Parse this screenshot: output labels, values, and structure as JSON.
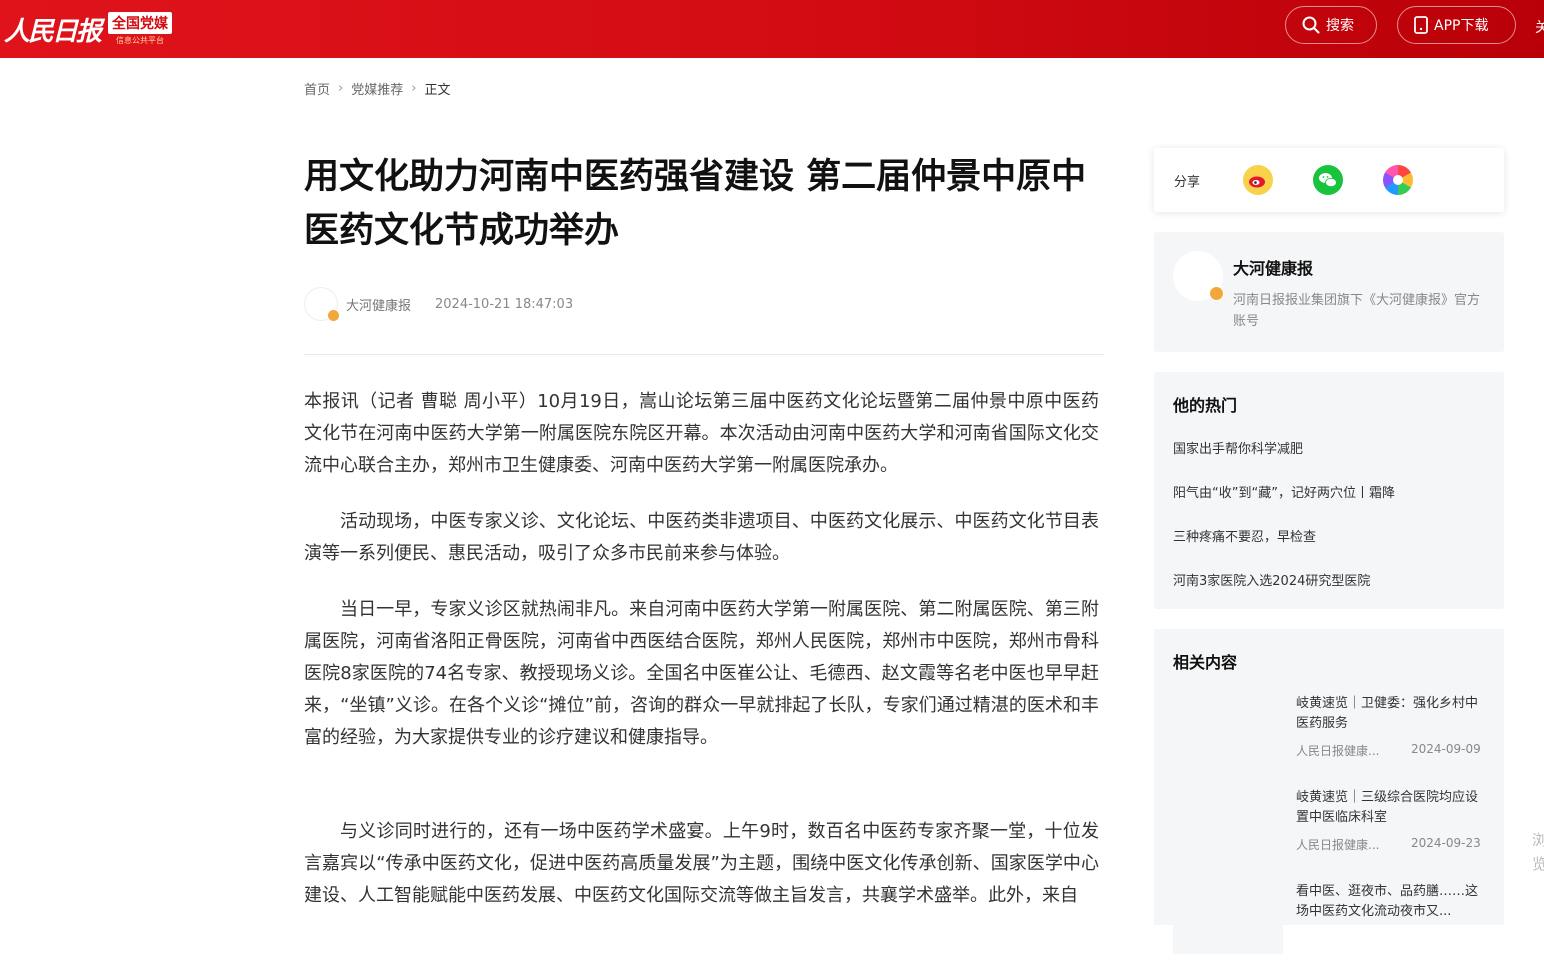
{
  "header": {
    "logo_text": "人民日报",
    "badge_title": "全国党媒",
    "badge_sub": "信息公共平台",
    "search_label": "搜索",
    "app_label": "APP下载",
    "more_label": "关"
  },
  "breadcrumb": {
    "home": "首页",
    "section": "党媒推荐",
    "current": "正文"
  },
  "article": {
    "title": "用文化助力河南中医药强省建设 第二届仲景中原中医药文化节成功举办",
    "author": "大河健康报",
    "date": "2024-10-21 18:47:03",
    "paragraphs": [
      "本报讯（记者 曹聪 周小平）10月19日，嵩山论坛第三届中医药文化论坛暨第二届仲景中原中医药文化节在河南中医药大学第一附属医院东院区开幕。本次活动由河南中医药大学和河南省国际文化交流中心联合主办，郑州市卫生健康委、河南中医药大学第一附属医院承办。",
      "活动现场，中医专家义诊、文化论坛、中医药类非遗项目、中医药文化展示、中医药文化节目表演等一系列便民、惠民活动，吸引了众多市民前来参与体验。",
      "当日一早，专家义诊区就热闹非凡。来自河南中医药大学第一附属医院、第二附属医院、第三附属医院，河南省洛阳正骨医院，河南省中西医结合医院，郑州人民医院，郑州市中医院，郑州市骨科医院8家医院的74名专家、教授现场义诊。全国名中医崔公让、毛德西、赵文霞等名老中医也早早赶来，“坐镇”义诊。在各个义诊“摊位”前，咨询的群众一早就排起了长队，专家们通过精湛的医术和丰富的经验，为大家提供专业的诊疗建议和健康指导。",
      "与义诊同时进行的，还有一场中医药学术盛宴。上午9时，数百名中医药专家齐聚一堂，十位发言嘉宾以“传承中医药文化，促进中医药高质量发展”为主题，围绕中医文化传承创新、国家医学中心建设、人工智能赋能中医药发展、中医药文化国际交流等做主旨发言，共襄学术盛举。此外，来自"
    ]
  },
  "sidebar": {
    "share_label": "分享",
    "account": {
      "name": "大河健康报",
      "desc": "河南日报报业集团旗下《大河健康报》官方账号"
    },
    "hot": {
      "title": "他的热门",
      "items": [
        "国家出手帮你科学减肥",
        "阳气由“收”到“藏”，记好两穴位丨霜降",
        "三种疼痛不要忍，早检查",
        "河南3家医院入选2024研究型医院"
      ]
    },
    "related": {
      "title": "相关内容",
      "items": [
        {
          "title": "岐黄速览｜卫健委：强化乡村中医药服务",
          "source": "人民日报健康...",
          "date": "2024-09-09"
        },
        {
          "title": "岐黄速览｜三级综合医院均应设置中医临床科室",
          "source": "人民日报健康...",
          "date": "2024-09-23"
        },
        {
          "title": "看中医、逛夜市、品药膳……这场中医药文化流动夜市又...",
          "source": "",
          "date": ""
        }
      ]
    }
  },
  "edge_text": "浏览"
}
